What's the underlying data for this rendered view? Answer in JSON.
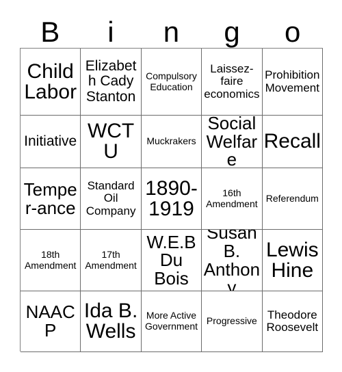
{
  "header": {
    "letters": [
      "B",
      "i",
      "n",
      "g",
      "o"
    ]
  },
  "grid": {
    "columns": 5,
    "rows": 5,
    "cells": [
      {
        "text": "Child Labor",
        "size": "xxl"
      },
      {
        "text": "Elizabeth Cady Stanton",
        "size": "l"
      },
      {
        "text": "Compulsory Education",
        "size": "s"
      },
      {
        "text": "Laissez-faire economics",
        "size": "m"
      },
      {
        "text": "Prohibition Movement",
        "size": "m"
      },
      {
        "text": "Initiative",
        "size": "l"
      },
      {
        "text": "WCTU",
        "size": "xxl"
      },
      {
        "text": "Muckrakers",
        "size": "s"
      },
      {
        "text": "Social Welfare",
        "size": "xl"
      },
      {
        "text": "Recall",
        "size": "xxl"
      },
      {
        "text": "Temper-ance",
        "size": "xl"
      },
      {
        "text": "Standard Oil Company",
        "size": "m"
      },
      {
        "text": "1890-1919",
        "size": "xxl"
      },
      {
        "text": "16th Amendment",
        "size": "s"
      },
      {
        "text": "Referendum",
        "size": "s"
      },
      {
        "text": "18th Amendment",
        "size": "s"
      },
      {
        "text": "17th Amendment",
        "size": "s"
      },
      {
        "text": "W.E.B Du Bois",
        "size": "xl"
      },
      {
        "text": "Susan B. Anthony",
        "size": "xl"
      },
      {
        "text": "Lewis Hine",
        "size": "xxl"
      },
      {
        "text": "NAACP",
        "size": "xl"
      },
      {
        "text": "Ida B. Wells",
        "size": "xxl"
      },
      {
        "text": "More Active Government",
        "size": "s"
      },
      {
        "text": "Progressive",
        "size": "s"
      },
      {
        "text": "Theodore Roosevelt",
        "size": "m"
      }
    ]
  },
  "colors": {
    "background": "#ffffff",
    "text": "#000000",
    "grid_line": "#6b6b6b"
  }
}
